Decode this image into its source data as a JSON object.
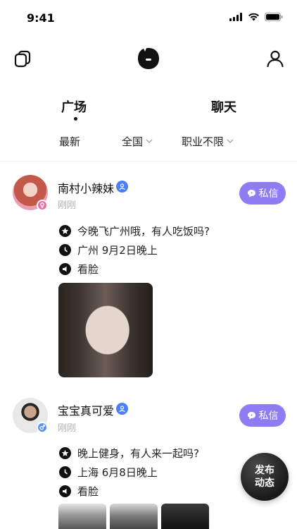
{
  "status_bar": {
    "time": "9:41"
  },
  "tabs": [
    {
      "label": "广场",
      "active": true
    },
    {
      "label": "聊天",
      "active": false
    }
  ],
  "filters": [
    {
      "label": "最新",
      "has_dropdown": false
    },
    {
      "label": "全国",
      "has_dropdown": true
    },
    {
      "label": "职业不限",
      "has_dropdown": true
    }
  ],
  "posts": [
    {
      "username": "南村小辣妹",
      "gender": "female",
      "verified": true,
      "time": "刚刚",
      "dm_label": "私信",
      "content": "今晚飞广州哦，有人吃饭吗?",
      "location_time": "广州 9月2日晚上",
      "requirement": "看脸"
    },
    {
      "username": "宝宝真可爱",
      "gender": "male",
      "verified": true,
      "time": "刚刚",
      "dm_label": "私信",
      "content": "晚上健身，有人来一起吗?",
      "location_time": "上海 6月8日晚上",
      "requirement": "看脸"
    }
  ],
  "fab": {
    "line1": "发布",
    "line2": "动态"
  },
  "colors": {
    "accent": "#8f7cf3",
    "verified": "#4d7ef7",
    "female_badge": "#f06ba0",
    "male_badge": "#5b8ff5",
    "muted_text": "#b0b0b0"
  }
}
